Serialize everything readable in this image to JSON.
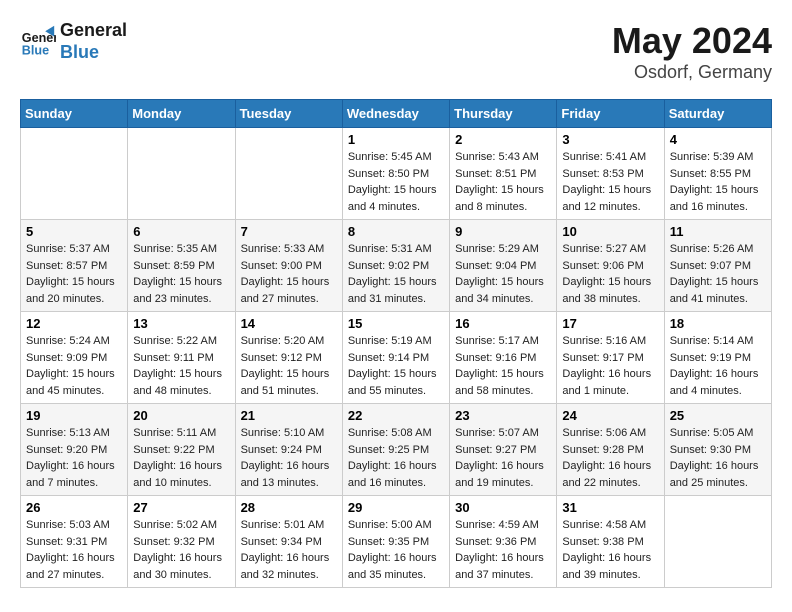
{
  "header": {
    "logo_line1": "General",
    "logo_line2": "Blue",
    "title": "May 2024",
    "subtitle": "Osdorf, Germany"
  },
  "weekdays": [
    "Sunday",
    "Monday",
    "Tuesday",
    "Wednesday",
    "Thursday",
    "Friday",
    "Saturday"
  ],
  "weeks": [
    [
      {
        "day": "",
        "info": ""
      },
      {
        "day": "",
        "info": ""
      },
      {
        "day": "",
        "info": ""
      },
      {
        "day": "1",
        "info": "Sunrise: 5:45 AM\nSunset: 8:50 PM\nDaylight: 15 hours\nand 4 minutes."
      },
      {
        "day": "2",
        "info": "Sunrise: 5:43 AM\nSunset: 8:51 PM\nDaylight: 15 hours\nand 8 minutes."
      },
      {
        "day": "3",
        "info": "Sunrise: 5:41 AM\nSunset: 8:53 PM\nDaylight: 15 hours\nand 12 minutes."
      },
      {
        "day": "4",
        "info": "Sunrise: 5:39 AM\nSunset: 8:55 PM\nDaylight: 15 hours\nand 16 minutes."
      }
    ],
    [
      {
        "day": "5",
        "info": "Sunrise: 5:37 AM\nSunset: 8:57 PM\nDaylight: 15 hours\nand 20 minutes."
      },
      {
        "day": "6",
        "info": "Sunrise: 5:35 AM\nSunset: 8:59 PM\nDaylight: 15 hours\nand 23 minutes."
      },
      {
        "day": "7",
        "info": "Sunrise: 5:33 AM\nSunset: 9:00 PM\nDaylight: 15 hours\nand 27 minutes."
      },
      {
        "day": "8",
        "info": "Sunrise: 5:31 AM\nSunset: 9:02 PM\nDaylight: 15 hours\nand 31 minutes."
      },
      {
        "day": "9",
        "info": "Sunrise: 5:29 AM\nSunset: 9:04 PM\nDaylight: 15 hours\nand 34 minutes."
      },
      {
        "day": "10",
        "info": "Sunrise: 5:27 AM\nSunset: 9:06 PM\nDaylight: 15 hours\nand 38 minutes."
      },
      {
        "day": "11",
        "info": "Sunrise: 5:26 AM\nSunset: 9:07 PM\nDaylight: 15 hours\nand 41 minutes."
      }
    ],
    [
      {
        "day": "12",
        "info": "Sunrise: 5:24 AM\nSunset: 9:09 PM\nDaylight: 15 hours\nand 45 minutes."
      },
      {
        "day": "13",
        "info": "Sunrise: 5:22 AM\nSunset: 9:11 PM\nDaylight: 15 hours\nand 48 minutes."
      },
      {
        "day": "14",
        "info": "Sunrise: 5:20 AM\nSunset: 9:12 PM\nDaylight: 15 hours\nand 51 minutes."
      },
      {
        "day": "15",
        "info": "Sunrise: 5:19 AM\nSunset: 9:14 PM\nDaylight: 15 hours\nand 55 minutes."
      },
      {
        "day": "16",
        "info": "Sunrise: 5:17 AM\nSunset: 9:16 PM\nDaylight: 15 hours\nand 58 minutes."
      },
      {
        "day": "17",
        "info": "Sunrise: 5:16 AM\nSunset: 9:17 PM\nDaylight: 16 hours\nand 1 minute."
      },
      {
        "day": "18",
        "info": "Sunrise: 5:14 AM\nSunset: 9:19 PM\nDaylight: 16 hours\nand 4 minutes."
      }
    ],
    [
      {
        "day": "19",
        "info": "Sunrise: 5:13 AM\nSunset: 9:20 PM\nDaylight: 16 hours\nand 7 minutes."
      },
      {
        "day": "20",
        "info": "Sunrise: 5:11 AM\nSunset: 9:22 PM\nDaylight: 16 hours\nand 10 minutes."
      },
      {
        "day": "21",
        "info": "Sunrise: 5:10 AM\nSunset: 9:24 PM\nDaylight: 16 hours\nand 13 minutes."
      },
      {
        "day": "22",
        "info": "Sunrise: 5:08 AM\nSunset: 9:25 PM\nDaylight: 16 hours\nand 16 minutes."
      },
      {
        "day": "23",
        "info": "Sunrise: 5:07 AM\nSunset: 9:27 PM\nDaylight: 16 hours\nand 19 minutes."
      },
      {
        "day": "24",
        "info": "Sunrise: 5:06 AM\nSunset: 9:28 PM\nDaylight: 16 hours\nand 22 minutes."
      },
      {
        "day": "25",
        "info": "Sunrise: 5:05 AM\nSunset: 9:30 PM\nDaylight: 16 hours\nand 25 minutes."
      }
    ],
    [
      {
        "day": "26",
        "info": "Sunrise: 5:03 AM\nSunset: 9:31 PM\nDaylight: 16 hours\nand 27 minutes."
      },
      {
        "day": "27",
        "info": "Sunrise: 5:02 AM\nSunset: 9:32 PM\nDaylight: 16 hours\nand 30 minutes."
      },
      {
        "day": "28",
        "info": "Sunrise: 5:01 AM\nSunset: 9:34 PM\nDaylight: 16 hours\nand 32 minutes."
      },
      {
        "day": "29",
        "info": "Sunrise: 5:00 AM\nSunset: 9:35 PM\nDaylight: 16 hours\nand 35 minutes."
      },
      {
        "day": "30",
        "info": "Sunrise: 4:59 AM\nSunset: 9:36 PM\nDaylight: 16 hours\nand 37 minutes."
      },
      {
        "day": "31",
        "info": "Sunrise: 4:58 AM\nSunset: 9:38 PM\nDaylight: 16 hours\nand 39 minutes."
      },
      {
        "day": "",
        "info": ""
      }
    ]
  ]
}
